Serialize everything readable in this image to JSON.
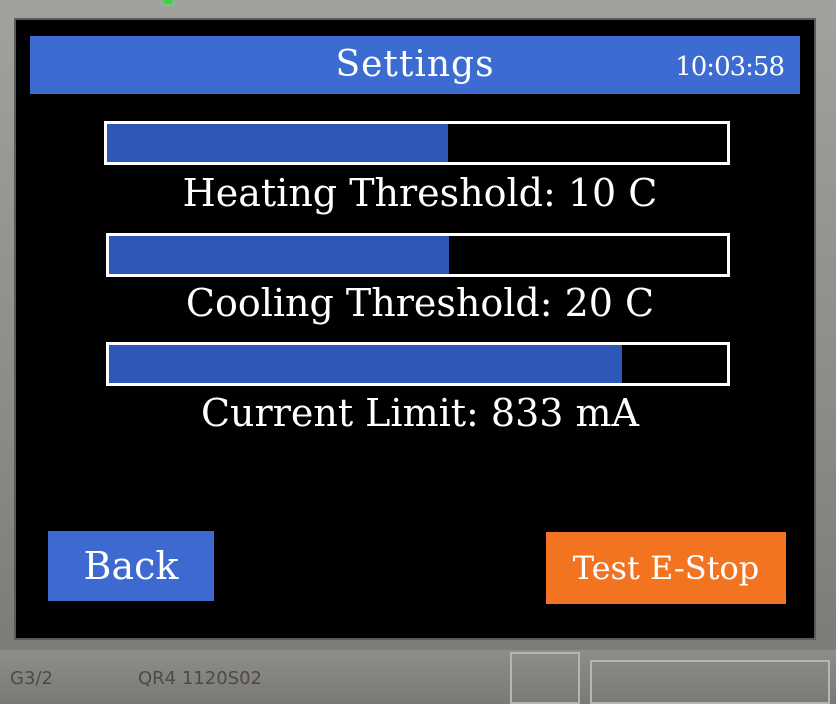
{
  "header": {
    "title": "Settings",
    "clock": "10:03:58"
  },
  "settings": [
    {
      "label": "Heating Threshold: 10 C",
      "level_fraction": 0.55
    },
    {
      "label": "Cooling Threshold: 20 C",
      "level_fraction": 0.55
    },
    {
      "label": "Current Limit: 833 mA",
      "level_fraction": 0.83
    }
  ],
  "buttons": {
    "back": "Back",
    "test_estop": "Test E-Stop"
  },
  "board": {
    "print_left": "G3/2",
    "print_right": "QR4  1120S02"
  },
  "colors": {
    "title_bar": "#3c6bd2",
    "bar_fill": "#2f57b8",
    "back_button": "#3d69d0",
    "estop_button": "#f37420"
  }
}
